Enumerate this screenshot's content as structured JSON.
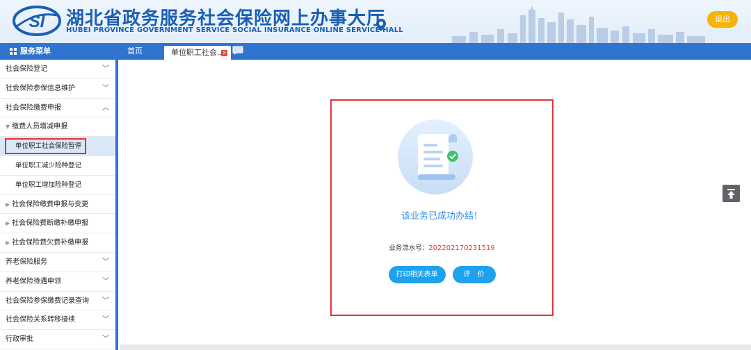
{
  "header": {
    "title_cn": "湖北省政务服务社会保险网上办事大厅",
    "title_en": "HUBEI PROVINCE GOVERNMENT SERVICE SOCIAL INSURANCE ONLINE SERVICE HALL",
    "logo_text": "SI",
    "logout_label": "退出"
  },
  "topbar": {
    "menu_title": "服务菜单",
    "tab_home": "首页",
    "tab_active": "单位职工社会...",
    "tab_close": "×"
  },
  "sidebar": {
    "items": [
      {
        "label": "社会保险登记",
        "chevron": "﹀"
      },
      {
        "label": "社会保险参保信息维护",
        "chevron": "﹀"
      },
      {
        "label": "社会保险缴费申报",
        "chevron": "︿"
      },
      {
        "label": "缴费人员增减申报",
        "marker": "▼"
      },
      {
        "label": "单位职工社会保险暂停"
      },
      {
        "label": "单位职工减少险种登记"
      },
      {
        "label": "单位职工增加险种登记"
      },
      {
        "label": "社会保险缴费申报与变更",
        "marker": "▶"
      },
      {
        "label": "社会保险费断缴补缴申报",
        "marker": "▶"
      },
      {
        "label": "社会保险费欠费补缴申报",
        "marker": "▶"
      },
      {
        "label": "养老保险服务",
        "chevron": "﹀"
      },
      {
        "label": "养老保险待遇申领",
        "chevron": "﹀"
      },
      {
        "label": "社会保险参保缴费记录查询",
        "chevron": "﹀"
      },
      {
        "label": "社会保险关系转移接续",
        "chevron": "﹀"
      },
      {
        "label": "行政审批",
        "chevron": "﹀"
      }
    ]
  },
  "result": {
    "message": "该业务已成功办结！",
    "serial_label": "业务流水号：",
    "serial_value": "202202170231519",
    "print_button": "打印相关表单",
    "eval_button": "评价"
  },
  "colors": {
    "brand_blue": "#2f74d0",
    "title_blue": "#1b5fb3",
    "accent_button": "#1ea1ef",
    "logout_orange": "#f6b30a",
    "highlight_red": "#e33434"
  }
}
